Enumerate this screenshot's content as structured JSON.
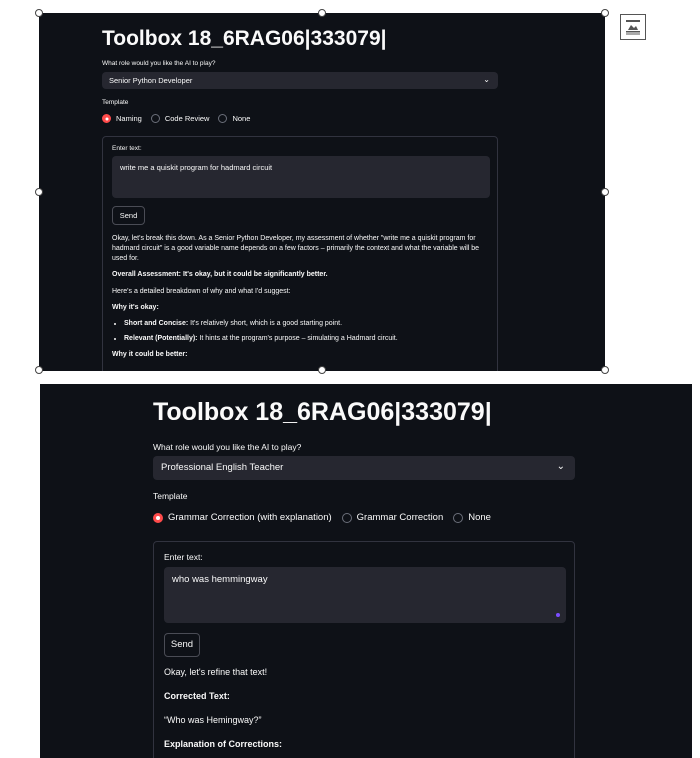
{
  "screenshot_top": {
    "title": "Toolbox 18_6RAG06|333079|",
    "role_label": "What role would you like the AI to play?",
    "role_value": "Senior Python Developer",
    "template_label": "Template",
    "template_options": [
      "Naming",
      "Code Review",
      "None"
    ],
    "template_selected": "Naming",
    "input_label": "Enter text:",
    "input_value": "write me a quiskit program for hadmard circuit",
    "send_label": "Send",
    "response": {
      "p1": "Okay, let's break this down. As a Senior Python Developer, my assessment of whether \"write me a quiskit program for hadmard circuit\" is a good variable name depends on a few factors – primarily the context and what the variable will be used for.",
      "p2": "Overall Assessment: It's okay, but it could be significantly better.",
      "p3": "Here's a detailed breakdown of why and what I'd suggest:",
      "h_okay": "Why it's okay:",
      "bullet1_bold": "Short and Concise:",
      "bullet1_text": " It's relatively short, which is a good starting point.",
      "bullet2_bold": "Relevant (Potentially):",
      "bullet2_text": " It hints at the program's purpose – simulating a Hadmard circuit.",
      "h_better": "Why it could be better:"
    }
  },
  "screenshot_bottom": {
    "title": "Toolbox 18_6RAG06|333079|",
    "role_label": "What role would you like the AI to play?",
    "role_value": "Professional English Teacher",
    "template_label": "Template",
    "template_options": [
      "Grammar Correction (with explanation)",
      "Grammar Correction",
      "None"
    ],
    "template_selected": "Grammar Correction (with explanation)",
    "input_label": "Enter text:",
    "input_value": "who was hemmingway",
    "send_label": "Send",
    "response": {
      "p1": "Okay, let's refine that text!",
      "p2": "Corrected Text:",
      "p3": "“Who was Hemingway?”",
      "p4": "Explanation of Corrections:"
    }
  },
  "colors": {
    "app_background": "#0e1117",
    "widget_background": "#262730",
    "accent": "#ff4b4b",
    "text": "#fafafa"
  }
}
